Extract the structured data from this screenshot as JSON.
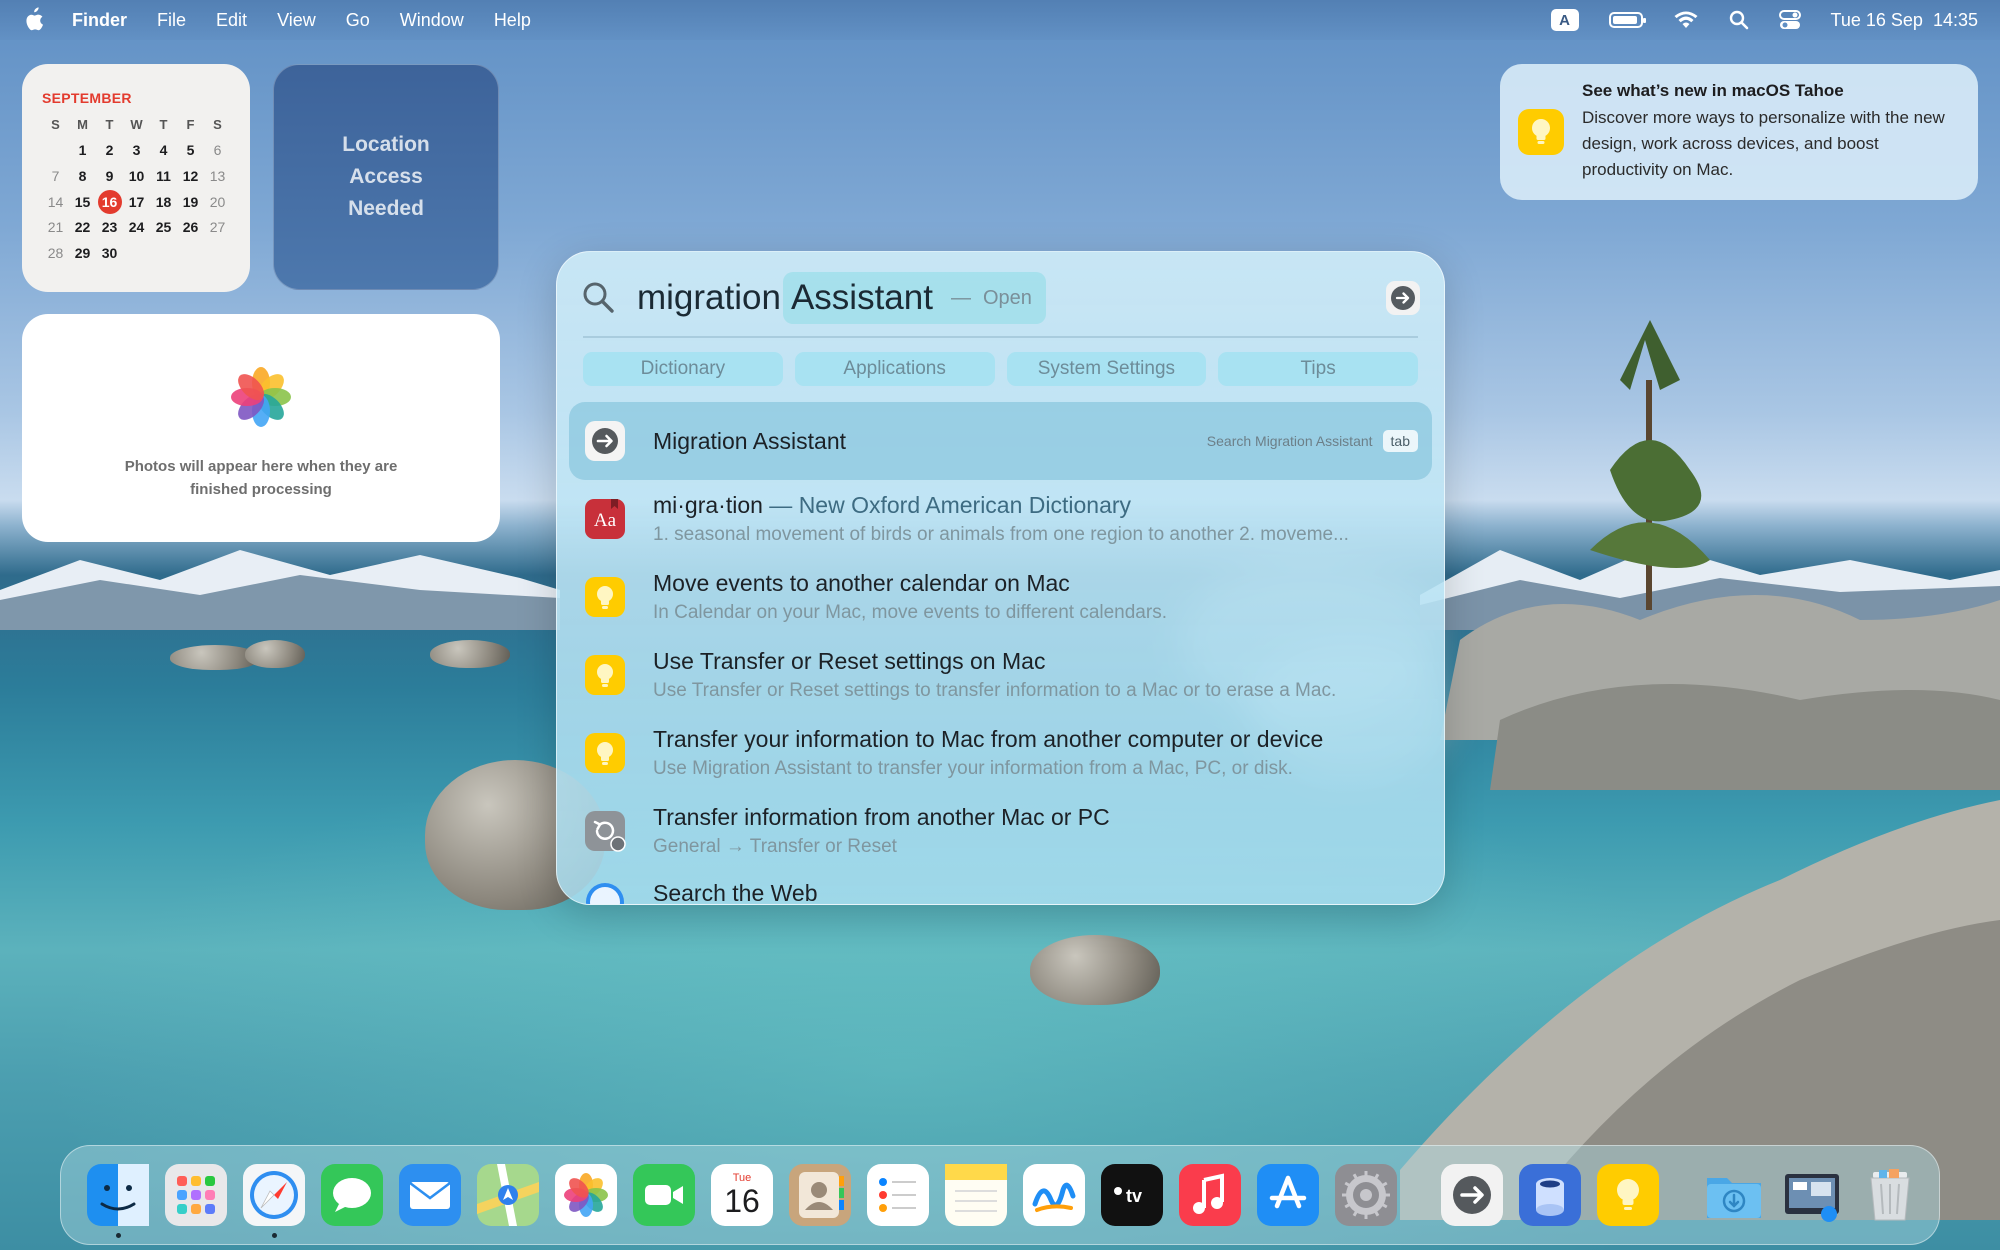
{
  "menubar": {
    "app_name": "Finder",
    "items": [
      "File",
      "Edit",
      "View",
      "Go",
      "Window",
      "Help"
    ],
    "input_badge": "A",
    "datetime": "Tue 16 Sep  14:35"
  },
  "calendar_widget": {
    "month": "SEPTEMBER",
    "weekdays": [
      "S",
      "M",
      "T",
      "W",
      "T",
      "F",
      "S"
    ],
    "today": "16",
    "weeks": [
      [
        "",
        "1",
        "2",
        "3",
        "4",
        "5",
        "6"
      ],
      [
        "7",
        "8",
        "9",
        "10",
        "11",
        "12",
        "13"
      ],
      [
        "14",
        "15",
        "16",
        "17",
        "18",
        "19",
        "20"
      ],
      [
        "21",
        "22",
        "23",
        "24",
        "25",
        "26",
        "27"
      ],
      [
        "28",
        "29",
        "30",
        "",
        "",
        "",
        ""
      ]
    ]
  },
  "location_widget": {
    "text": "Location Access Needed"
  },
  "photos_widget": {
    "text": "Photos will appear here when they are finished processing"
  },
  "tips_notification": {
    "title": "See what’s new in macOS Tahoe",
    "body": "Discover more ways to personalize with the new design, work across devices, and boost productivity on Mac."
  },
  "spotlight": {
    "query": "migration",
    "completion": "Assistant",
    "completion_separator": "—",
    "completion_action": "Open",
    "categories": [
      "Dictionary",
      "Applications",
      "System Settings",
      "Tips"
    ],
    "results": [
      {
        "title": "Migration Assistant",
        "hint": "Search Migration Assistant",
        "key": "tab",
        "icon": "migration-assistant-icon"
      },
      {
        "title": "mi·gra·tion",
        "source": " — New Oxford American Dictionary",
        "subtitle": "1. seasonal movement of birds or animals from one region to another 2. moveme...",
        "icon": "dictionary-icon"
      },
      {
        "title": "Move events to another calendar on Mac",
        "subtitle": "In Calendar on your Mac, move events to different calendars.",
        "icon": "tips-icon"
      },
      {
        "title": "Use Transfer or Reset settings on Mac",
        "subtitle": "Use Transfer or Reset settings to transfer information to a Mac or to erase a Mac.",
        "icon": "tips-icon"
      },
      {
        "title": "Transfer your information to Mac from another computer or device",
        "subtitle": "Use Migration Assistant to transfer your information from a Mac, PC, or disk.",
        "icon": "tips-icon"
      },
      {
        "title": "Transfer information from another Mac or PC",
        "subtitle": "General → Transfer or Reset",
        "icon": "transfer-reset-icon"
      },
      {
        "title": "Search the Web",
        "icon": "safari-icon"
      }
    ]
  },
  "dock": {
    "apps": [
      {
        "name": "finder-icon",
        "color": "#1e8ff0",
        "running": true
      },
      {
        "name": "launchpad-icon",
        "color": "#e8e8ea",
        "running": false
      },
      {
        "name": "safari-icon",
        "color": "#f4f6f8",
        "running": true
      },
      {
        "name": "messages-icon",
        "color": "#34c759",
        "running": false
      },
      {
        "name": "mail-icon",
        "color": "#2d8ff0",
        "running": false
      },
      {
        "name": "maps-icon",
        "color": "#7cc27a",
        "running": false
      },
      {
        "name": "photos-icon",
        "color": "#ffffff",
        "running": false
      },
      {
        "name": "facetime-icon",
        "color": "#34c759",
        "running": false
      },
      {
        "name": "calendar-icon",
        "color": "#ffffff",
        "running": false,
        "label_top": "Tue",
        "label_day": "16"
      },
      {
        "name": "contacts-icon",
        "color": "#c8a57c",
        "running": false
      },
      {
        "name": "reminders-icon",
        "color": "#ffffff",
        "running": false
      },
      {
        "name": "notes-icon",
        "color": "#ffd94a",
        "running": false
      },
      {
        "name": "freeform-icon",
        "color": "#ffffff",
        "running": false
      },
      {
        "name": "apple-tv-icon",
        "color": "#111111",
        "running": false,
        "label": "tv"
      },
      {
        "name": "music-icon",
        "color": "#fa3c4c",
        "running": false
      },
      {
        "name": "app-store-icon",
        "color": "#1f8ef5",
        "running": false
      },
      {
        "name": "system-settings-icon",
        "color": "#8e8e93",
        "running": false
      }
    ],
    "recent_apps": [
      {
        "name": "migration-assistant-icon",
        "color": "#f2f2f2",
        "running": false
      },
      {
        "name": "preview-icon",
        "color": "#3a6fd8",
        "running": false
      },
      {
        "name": "tips-icon",
        "color": "#ffcc00",
        "running": false
      }
    ],
    "stacks": [
      {
        "name": "downloads-folder-icon",
        "color": "#5fb4ea"
      },
      {
        "name": "screenshot-stack-icon",
        "color": "#2a3140"
      },
      {
        "name": "trash-icon",
        "color": "#d9dde0"
      }
    ]
  }
}
